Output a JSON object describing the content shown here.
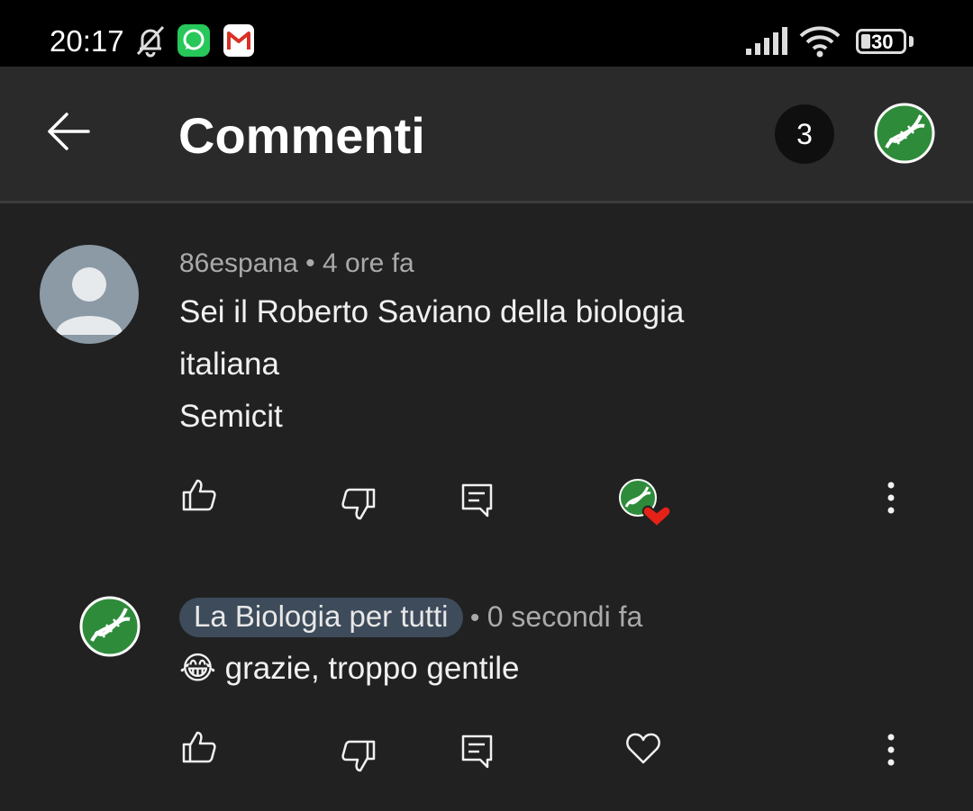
{
  "status_bar": {
    "time": "20:17",
    "battery": "30"
  },
  "header": {
    "title": "Commenti",
    "count": "3"
  },
  "comment": {
    "author": "86espana",
    "time": "4 ore fa",
    "lines": [
      "Sei il Roberto Saviano della biologia",
      "italiana",
      "Semicit"
    ]
  },
  "reply": {
    "author": "La Biologia per tutti",
    "time": "0 secondi fa",
    "emoji": "😂",
    "text": "grazie, troppo gentile"
  },
  "colors": {
    "background": "#212121",
    "header": "#2a2a2a",
    "author_chip": "#3d4b5a",
    "logo_green": "#2e8b3a",
    "heart_red": "#e62117"
  }
}
